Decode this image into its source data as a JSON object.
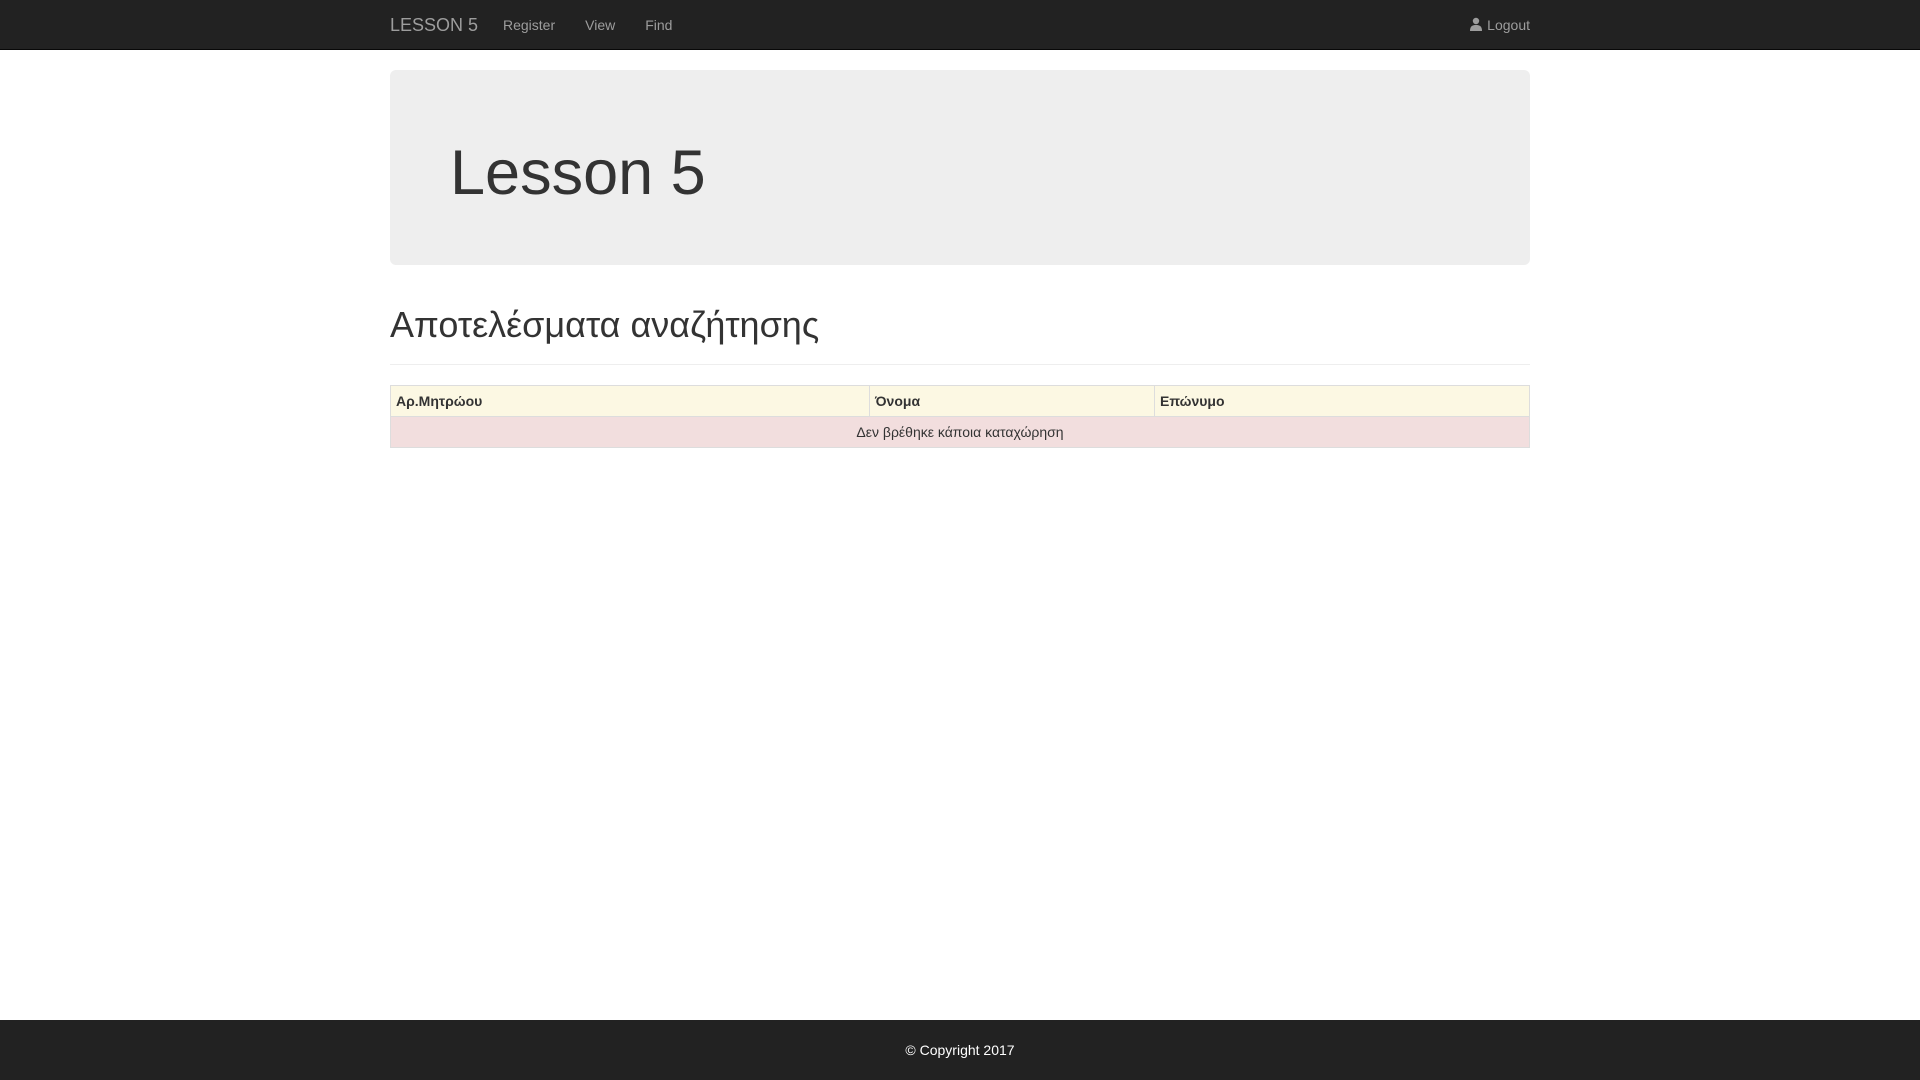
{
  "navbar": {
    "brand": "LESSON 5",
    "links": [
      "Register",
      "View",
      "Find"
    ],
    "logout_label": "Logout",
    "logout_icon": "user-icon"
  },
  "jumbotron": {
    "title": "Lesson 5"
  },
  "results": {
    "heading": "Αποτελέσματα αναζήτησης",
    "columns": [
      "Αρ.Μητρώου",
      "Όνομα",
      "Επώνυμο"
    ],
    "empty_message": "Δεν βρέθηκε κάποια καταχώρηση"
  },
  "footer": {
    "copyright": "© Copyright 2017"
  },
  "colors": {
    "navbar_bg": "#222222",
    "header_row_bg": "#fcf8e3",
    "empty_row_bg": "#f2dede",
    "jumbotron_bg": "#eeeeee"
  }
}
